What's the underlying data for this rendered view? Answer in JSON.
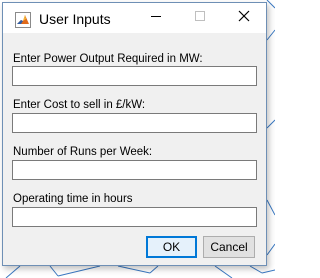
{
  "window": {
    "title": "User Inputs",
    "icon": "matlab-icon",
    "controls": {
      "minimize": "minimize-icon",
      "maximize": "maximize-icon",
      "close": "close-icon"
    }
  },
  "fields": [
    {
      "label": "Enter Power Output Required in MW:",
      "value": ""
    },
    {
      "label": "Enter Cost to sell in £/kW:",
      "value": ""
    },
    {
      "label": "Number of Runs per Week:",
      "value": ""
    },
    {
      "label": "Operating time in hours",
      "value": ""
    }
  ],
  "buttons": {
    "ok": "OK",
    "cancel": "Cancel"
  },
  "colors": {
    "focus_accent": "#0078d7",
    "dialog_background": "#f0f0f0",
    "background_lines": "#3a79c3"
  }
}
